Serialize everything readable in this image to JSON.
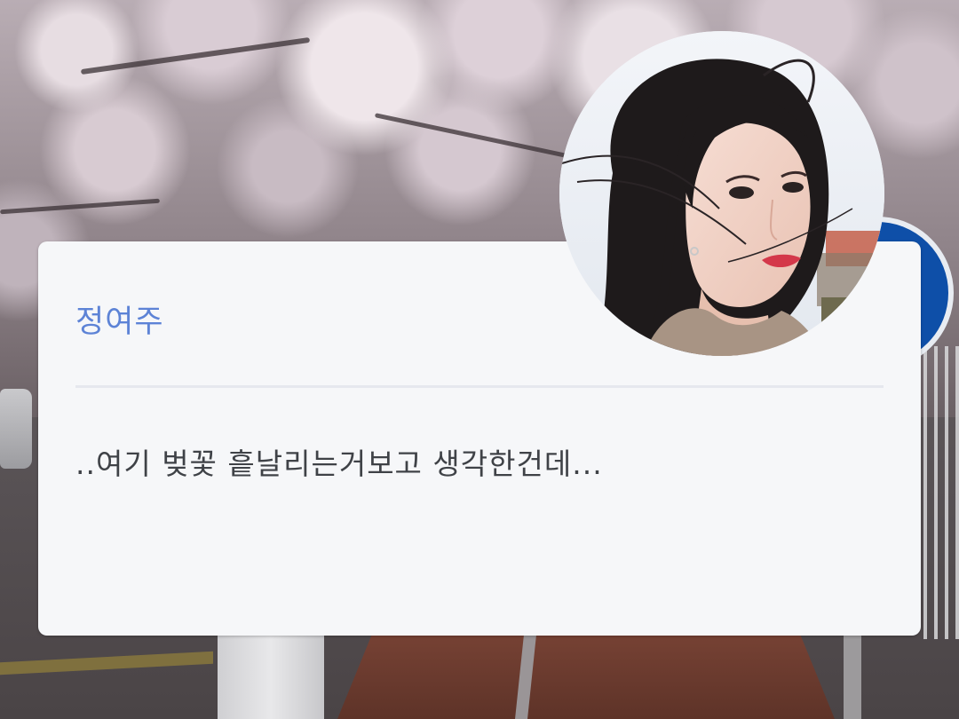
{
  "card": {
    "name": "정여주",
    "message": "..여기 벚꽃 흩날리는거보고 생각한건데..."
  },
  "colors": {
    "name_accent": "#5d83d6",
    "message_text": "#3f4247",
    "card_background": "#f6f7f9"
  }
}
